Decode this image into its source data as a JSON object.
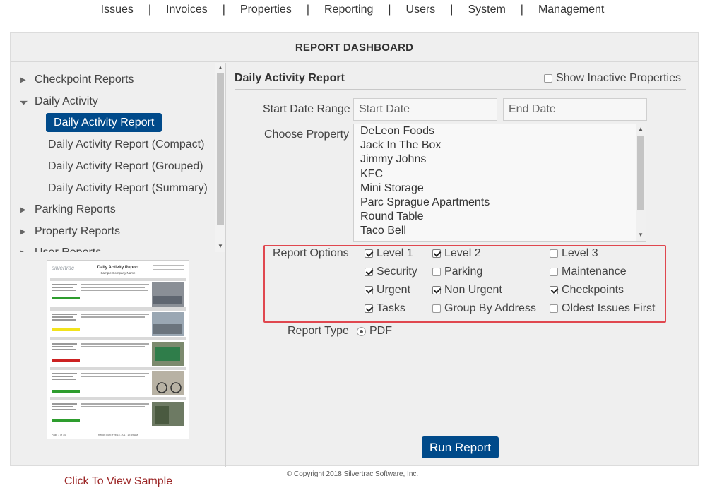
{
  "nav": {
    "items": [
      "Issues",
      "Invoices",
      "Properties",
      "Reporting",
      "Users",
      "System",
      "Management"
    ],
    "separator": "|"
  },
  "panel": {
    "title": "REPORT DASHBOARD"
  },
  "sidebar": {
    "checkpoint_reports": "Checkpoint Reports",
    "daily_activity": "Daily Activity",
    "daily_activity_report": "Daily Activity Report",
    "daily_activity_compact": "Daily Activity Report (Compact)",
    "daily_activity_grouped": "Daily Activity Report (Grouped)",
    "daily_activity_summary": "Daily Activity Report (Summary)",
    "parking_reports": "Parking Reports",
    "property_reports": "Property Reports",
    "user_reports": "User Reports",
    "sample_link": "Click To View Sample"
  },
  "sample": {
    "logo": "silvertrac",
    "title": "Daily Activity Report",
    "company": "Sample Company Name",
    "footer_left": "Page 1 of 14",
    "footer_center": "Report Run: Feb 15, 2017 12:59 AM"
  },
  "report": {
    "title": "Daily Activity Report",
    "show_inactive_label": "Show Inactive Properties",
    "start_date_label": "Start Date Range",
    "start_date_placeholder": "Start Date",
    "end_date_placeholder": "End Date",
    "choose_property_label": "Choose Property",
    "properties": [
      "DeLeon Foods",
      "Jack In The Box",
      "Jimmy Johns",
      "KFC",
      "Mini Storage",
      "Parc Sprague Apartments",
      "Round Table",
      "Taco Bell"
    ],
    "report_options_label": "Report Options",
    "options": {
      "level1": {
        "label": "Level 1",
        "checked": true
      },
      "level2": {
        "label": "Level 2",
        "checked": true
      },
      "level3": {
        "label": "Level 3",
        "checked": false
      },
      "security": {
        "label": "Security",
        "checked": true
      },
      "parking": {
        "label": "Parking",
        "checked": false
      },
      "maintenance": {
        "label": "Maintenance",
        "checked": false
      },
      "urgent": {
        "label": "Urgent",
        "checked": true
      },
      "non_urgent": {
        "label": "Non Urgent",
        "checked": true
      },
      "checkpoints": {
        "label": "Checkpoints",
        "checked": true
      },
      "tasks": {
        "label": "Tasks",
        "checked": true
      },
      "group_by_address": {
        "label": "Group By Address",
        "checked": false
      },
      "oldest_first": {
        "label": "Oldest Issues First",
        "checked": false
      }
    },
    "report_type_label": "Report Type",
    "report_type_pdf": "PDF",
    "run_button": "Run Report"
  },
  "footer": {
    "copyright": "© Copyright 2018 Silvertrac Software, Inc."
  },
  "colors": {
    "primary": "#004a8a",
    "highlight_border": "#e0474f",
    "sample_link": "#9b2525",
    "panel_bg": "#efefef"
  }
}
